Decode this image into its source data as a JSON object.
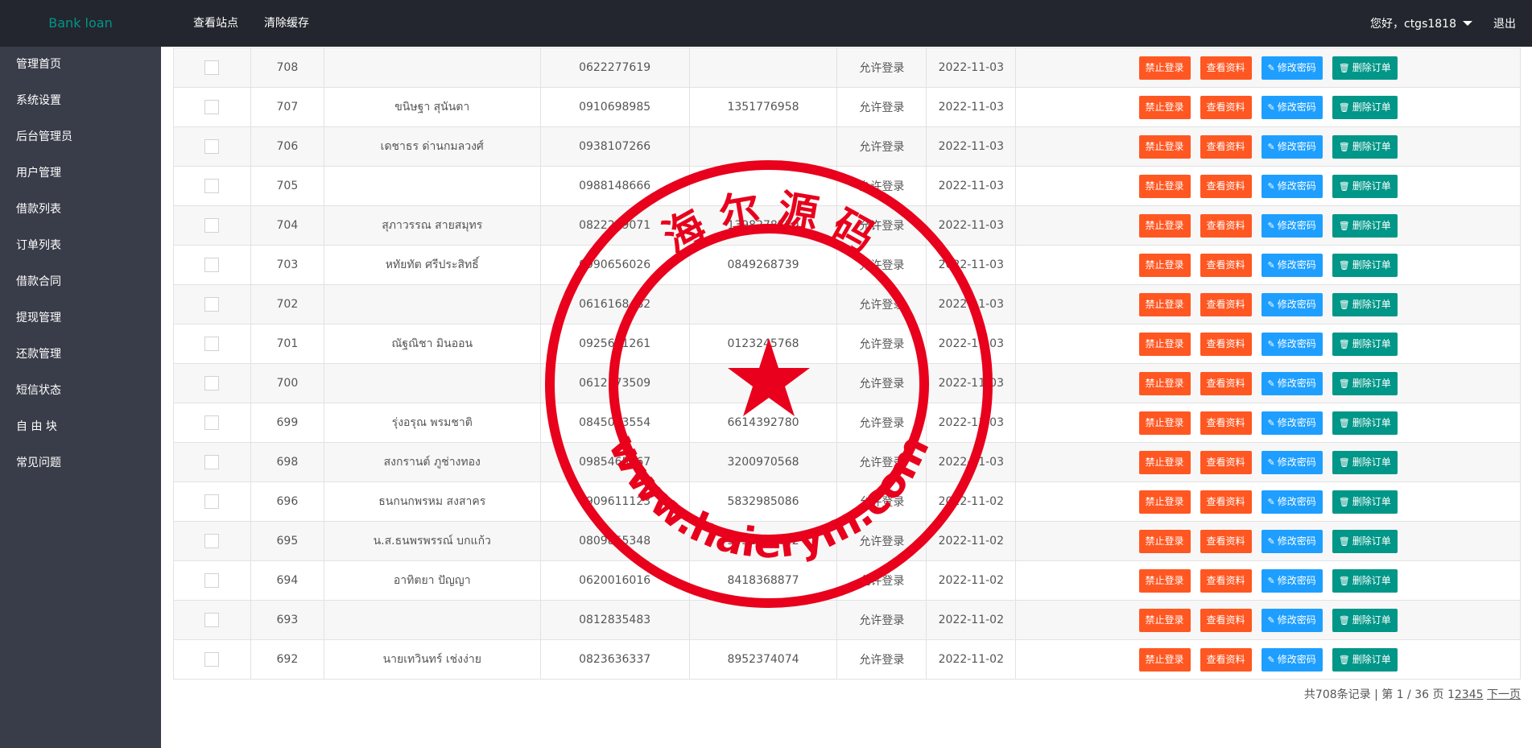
{
  "app": {
    "logo": "Bank loan"
  },
  "topnav": {
    "view_site": "查看站点",
    "clear_cache": "清除缓存"
  },
  "user": {
    "greeting": "您好，ctgs1818",
    "logout": "退出"
  },
  "sidebar": {
    "items": [
      {
        "label": "管理首页"
      },
      {
        "label": "系统设置"
      },
      {
        "label": "后台管理员"
      },
      {
        "label": "用户管理"
      },
      {
        "label": "借款列表"
      },
      {
        "label": "订单列表"
      },
      {
        "label": "借款合同"
      },
      {
        "label": "提现管理"
      },
      {
        "label": "还款管理"
      },
      {
        "label": "短信状态"
      },
      {
        "label": "自 由 块"
      },
      {
        "label": "常见问题"
      }
    ]
  },
  "actions": {
    "ban": "禁止登录",
    "view": "查看资料",
    "password": "修改密码",
    "delete": "删除订单"
  },
  "table": {
    "rows": [
      {
        "id": "708",
        "name": "",
        "phone": "0622277619",
        "account": "",
        "status": "允许登录",
        "date": "2022-11-03"
      },
      {
        "id": "707",
        "name": "ขนิษฐา สุนันตา",
        "phone": "0910698985",
        "account": "1351776958",
        "status": "允许登录",
        "date": "2022-11-03"
      },
      {
        "id": "706",
        "name": "เดชาธร ด่านกมลวงศ์",
        "phone": "0938107266",
        "account": "",
        "status": "允许登录",
        "date": "2022-11-03"
      },
      {
        "id": "705",
        "name": "",
        "phone": "0988148666",
        "account": "",
        "status": "允许登录",
        "date": "2022-11-03"
      },
      {
        "id": "704",
        "name": "สุภาวรรณ สายสมุทร",
        "phone": "0822279071",
        "account": "1398278530",
        "status": "允许登录",
        "date": "2022-11-03"
      },
      {
        "id": "703",
        "name": "หทัยทัต ศรีประสิทธิ์",
        "phone": "0990656026",
        "account": "0849268739",
        "status": "允许登录",
        "date": "2022-11-03"
      },
      {
        "id": "702",
        "name": "",
        "phone": "0616168482",
        "account": "",
        "status": "允许登录",
        "date": "2022-11-03"
      },
      {
        "id": "701",
        "name": "ณัฐณิชา มินออน",
        "phone": "0925631261",
        "account": "0123245768",
        "status": "允许登录",
        "date": "2022-11-03"
      },
      {
        "id": "700",
        "name": "",
        "phone": "0612173509",
        "account": "",
        "status": "允许登录",
        "date": "2022-11-03"
      },
      {
        "id": "699",
        "name": "รุ่งอรุณ พรมชาติ",
        "phone": "0845003554",
        "account": "6614392780",
        "status": "允许登录",
        "date": "2022-11-03"
      },
      {
        "id": "698",
        "name": "สงกรานต์ ภูช่างทอง",
        "phone": "0985465167",
        "account": "3200970568",
        "status": "允许登录",
        "date": "2022-11-03"
      },
      {
        "id": "696",
        "name": "ธนกนกพรหม สงสาคร",
        "phone": "0909611123",
        "account": "5832985086",
        "status": "允许登录",
        "date": "2022-11-02"
      },
      {
        "id": "695",
        "name": "น.ส.ธนพรพรรณ์ บกแก้ว",
        "phone": "0809855348",
        "account": "3432117622",
        "status": "允许登录",
        "date": "2022-11-02"
      },
      {
        "id": "694",
        "name": "อาทิตยา ปัญญา",
        "phone": "0620016016",
        "account": "8418368877",
        "status": "允许登录",
        "date": "2022-11-02"
      },
      {
        "id": "693",
        "name": "",
        "phone": "0812835483",
        "account": "",
        "status": "允许登录",
        "date": "2022-11-02"
      },
      {
        "id": "692",
        "name": "นายเทวินทร์ เช่งง่าย",
        "phone": "0823636337",
        "account": "8952374074",
        "status": "允许登录",
        "date": "2022-11-02"
      }
    ]
  },
  "pager": {
    "summary": "共708条记录 | 第 1 / 36 页 ",
    "current": "1",
    "pages": [
      "2",
      "3",
      "4",
      "5"
    ],
    "next": "下一页"
  },
  "watermark": {
    "top_text": "海 尔 源 码",
    "bottom_text": "www.haierym.com",
    "color": "#e8001c"
  }
}
